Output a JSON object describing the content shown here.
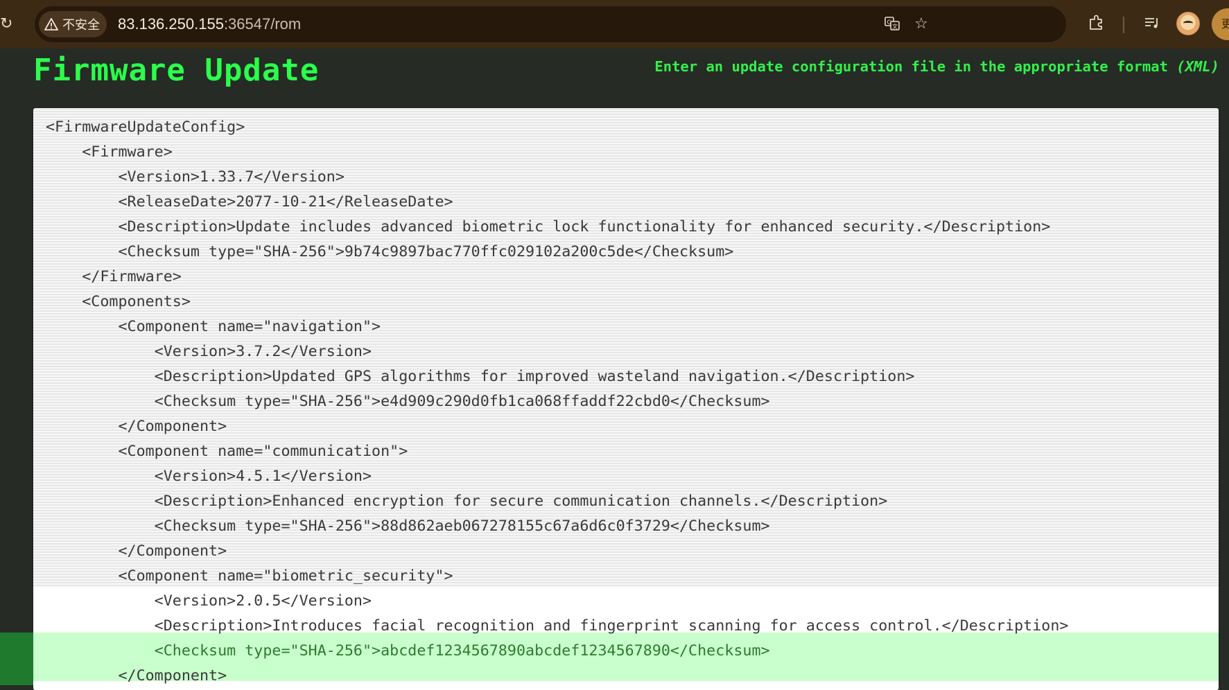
{
  "browser": {
    "security_label": "不安全",
    "url_host": "83.136.250.155",
    "url_path": ":36547/rom",
    "edge_button_label": "更",
    "icons": {
      "reload": "reload-icon",
      "warning": "warning-icon",
      "translate": "translate-icon",
      "bookmark": "bookmark-star-icon",
      "extensions": "extensions-icon",
      "media": "media-control-icon",
      "avatar": "profile-avatar"
    }
  },
  "page": {
    "title": "Firmware Update",
    "instruction": "Enter an update configuration file in the appropriate format",
    "instruction_format": "(XML)",
    "colors": {
      "accent_green": "#2bff4b",
      "page_bg": "#262b26",
      "highlight": "#c8ffcc"
    }
  },
  "editor": {
    "lines": [
      "<FirmwareUpdateConfig>",
      "    <Firmware>",
      "        <Version>1.33.7</Version>",
      "        <ReleaseDate>2077-10-21</ReleaseDate>",
      "        <Description>Update includes advanced biometric lock functionality for enhanced security.</Description>",
      "        <Checksum type=\"SHA-256\">9b74c9897bac770ffc029102a200c5de</Checksum>",
      "    </Firmware>",
      "    <Components>",
      "        <Component name=\"navigation\">",
      "            <Version>3.7.2</Version>",
      "            <Description>Updated GPS algorithms for improved wasteland navigation.</Description>",
      "            <Checksum type=\"SHA-256\">e4d909c290d0fb1ca068ffaddf22cbd0</Checksum>",
      "        </Component>",
      "        <Component name=\"communication\">",
      "            <Version>4.5.1</Version>",
      "            <Description>Enhanced encryption for secure communication channels.</Description>",
      "            <Checksum type=\"SHA-256\">88d862aeb067278155c67a6d6c0f3729</Checksum>",
      "        </Component>",
      "        <Component name=\"biometric_security\">",
      "            <Version>2.0.5</Version>",
      "            <Description>Introduces facial recognition and fingerprint scanning for access control.</Description>",
      "            <Checksum type=\"SHA-256\">abcdef1234567890abcdef1234567890</Checksum>",
      "        </Component>"
    ]
  }
}
